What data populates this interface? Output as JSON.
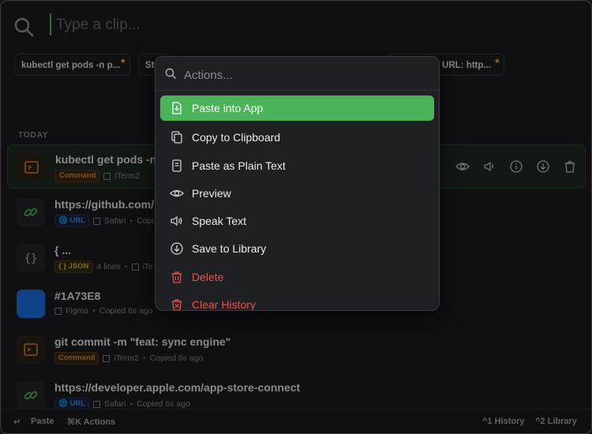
{
  "search": {
    "placeholder": "Type a clip..."
  },
  "pinned": [
    {
      "label": "kubectl get pods -n p..."
    },
    {
      "label": "St"
    },
    {
      "label": "g URL: http..."
    }
  ],
  "section_label": "TODAY",
  "clips": [
    {
      "title": "kubectl get pods -n",
      "badge": "Command",
      "app": "iTerm2",
      "copied": ""
    },
    {
      "title": "https://github.com/",
      "badge": "URL",
      "app": "Safari",
      "copied": "Copi"
    },
    {
      "title": "{ ...",
      "badge": "{ } JSON",
      "app": "4 lines",
      "copied": "iTe"
    },
    {
      "title": "#1A73E8",
      "badge": "",
      "app": "Figma",
      "copied": "Copied 6s ago"
    },
    {
      "title": "git commit -m \"feat: sync engine\"",
      "badge": "Command",
      "app": "iTerm2",
      "copied": "Copied 6s ago"
    },
    {
      "title": "https://developer.apple.com/app-store-connect",
      "badge": "URL",
      "app": "Safari",
      "copied": "Copied 6s ago"
    }
  ],
  "footer": {
    "paste": "Paste",
    "actions": "⌘K Actions",
    "history": "^1 History",
    "library": "^2 Library"
  },
  "popup": {
    "placeholder": "Actions...",
    "items": [
      {
        "label": "Paste into App",
        "icon": "paste-icon"
      },
      {
        "label": "Copy to Clipboard",
        "icon": "copy-icon"
      },
      {
        "label": "Paste as Plain Text",
        "icon": "document-icon"
      },
      {
        "label": "Preview",
        "icon": "eye-icon"
      },
      {
        "label": "Speak Text",
        "icon": "speaker-icon"
      },
      {
        "label": "Save to Library",
        "icon": "download-circle-icon"
      },
      {
        "label": "Delete",
        "icon": "trash-icon"
      },
      {
        "label": "Clear History",
        "icon": "trash-all-icon"
      }
    ]
  },
  "colors": {
    "accent": "#4bb45a",
    "danger": "#e8524a",
    "command": "#e08a2c",
    "url": "#5b8ae6",
    "json": "#d9b531",
    "swatch": "#1A73E8"
  }
}
